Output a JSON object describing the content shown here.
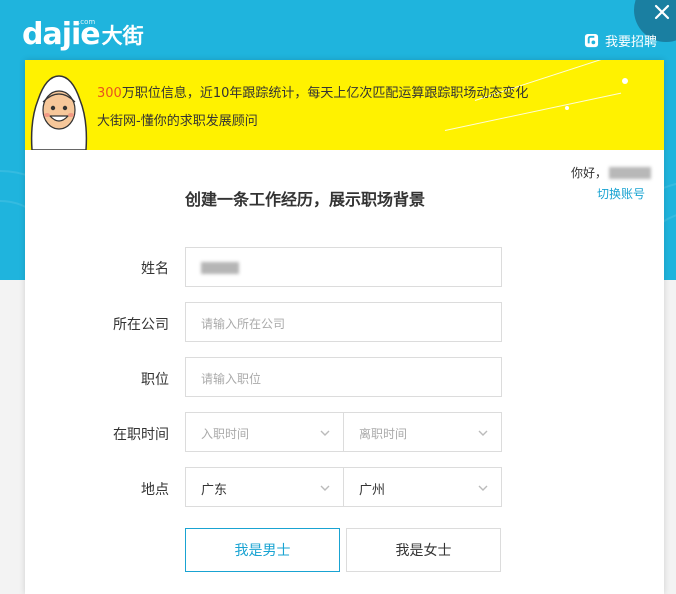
{
  "header": {
    "logo_latin": "dajie",
    "logo_sup": ".com",
    "logo_cn": "大街",
    "recruit_label": "我要招聘"
  },
  "banner": {
    "line1_highlight": "300",
    "line1_rest": "万职位信息，近10年跟踪统计，每天上亿次匹配运算跟踪职场动态变化",
    "line2": "大街网-懂你的求职发展顾问"
  },
  "account": {
    "greeting": "你好，",
    "switch_label": "切换账号"
  },
  "form": {
    "title": "创建一条工作经历，展示职场背景",
    "name_label": "姓名",
    "company_label": "所在公司",
    "company_placeholder": "请输入所在公司",
    "position_label": "职位",
    "position_placeholder": "请输入职位",
    "period_label": "在职时间",
    "start_placeholder": "入职时间",
    "end_placeholder": "离职时间",
    "location_label": "地点",
    "province_value": "广东",
    "city_value": "广州",
    "gender_male": "我是男士",
    "gender_female": "我是女士"
  },
  "colors": {
    "header_bg": "#1fb4dd",
    "banner_bg": "#fff200",
    "highlight": "#e8541e",
    "accent": "#19a3d2"
  }
}
